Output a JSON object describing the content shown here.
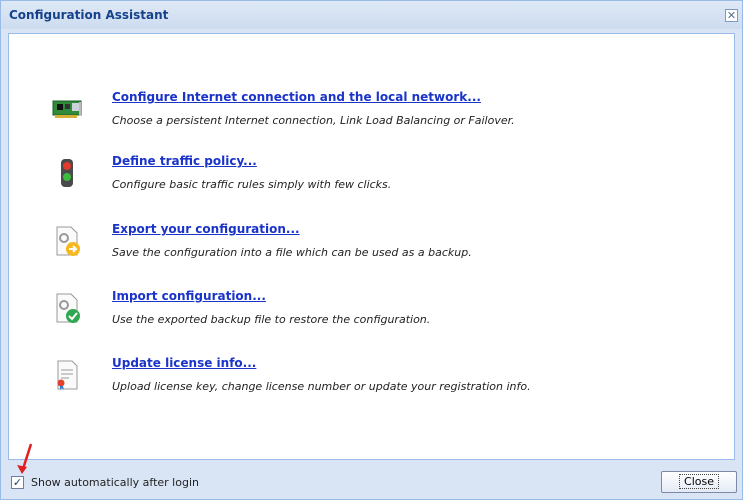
{
  "window": {
    "title": "Configuration Assistant"
  },
  "items": [
    {
      "icon": "network-card-icon",
      "link": "Configure Internet connection and the local network...",
      "desc": "Choose a persistent Internet connection, Link Load Balancing or Failover."
    },
    {
      "icon": "traffic-light-icon",
      "link": "Define traffic policy...",
      "desc": "Configure basic traffic rules simply with few clicks."
    },
    {
      "icon": "export-config-icon",
      "link": "Export your configuration...",
      "desc": "Save the configuration into a file which can be used as a backup."
    },
    {
      "icon": "import-config-icon",
      "link": "Import configuration...",
      "desc": "Use the exported backup file to restore the configuration."
    },
    {
      "icon": "license-document-icon",
      "link": "Update license info...",
      "desc": "Upload license key, change license number or update your registration info."
    }
  ],
  "footer": {
    "checkbox_label": "Show automatically after login",
    "checked": true,
    "close_label": "Close"
  },
  "colors": {
    "link": "#1a33c8",
    "title": "#15428b",
    "frame": "#d9e5f5",
    "annotation_arrow": "#e02020"
  }
}
